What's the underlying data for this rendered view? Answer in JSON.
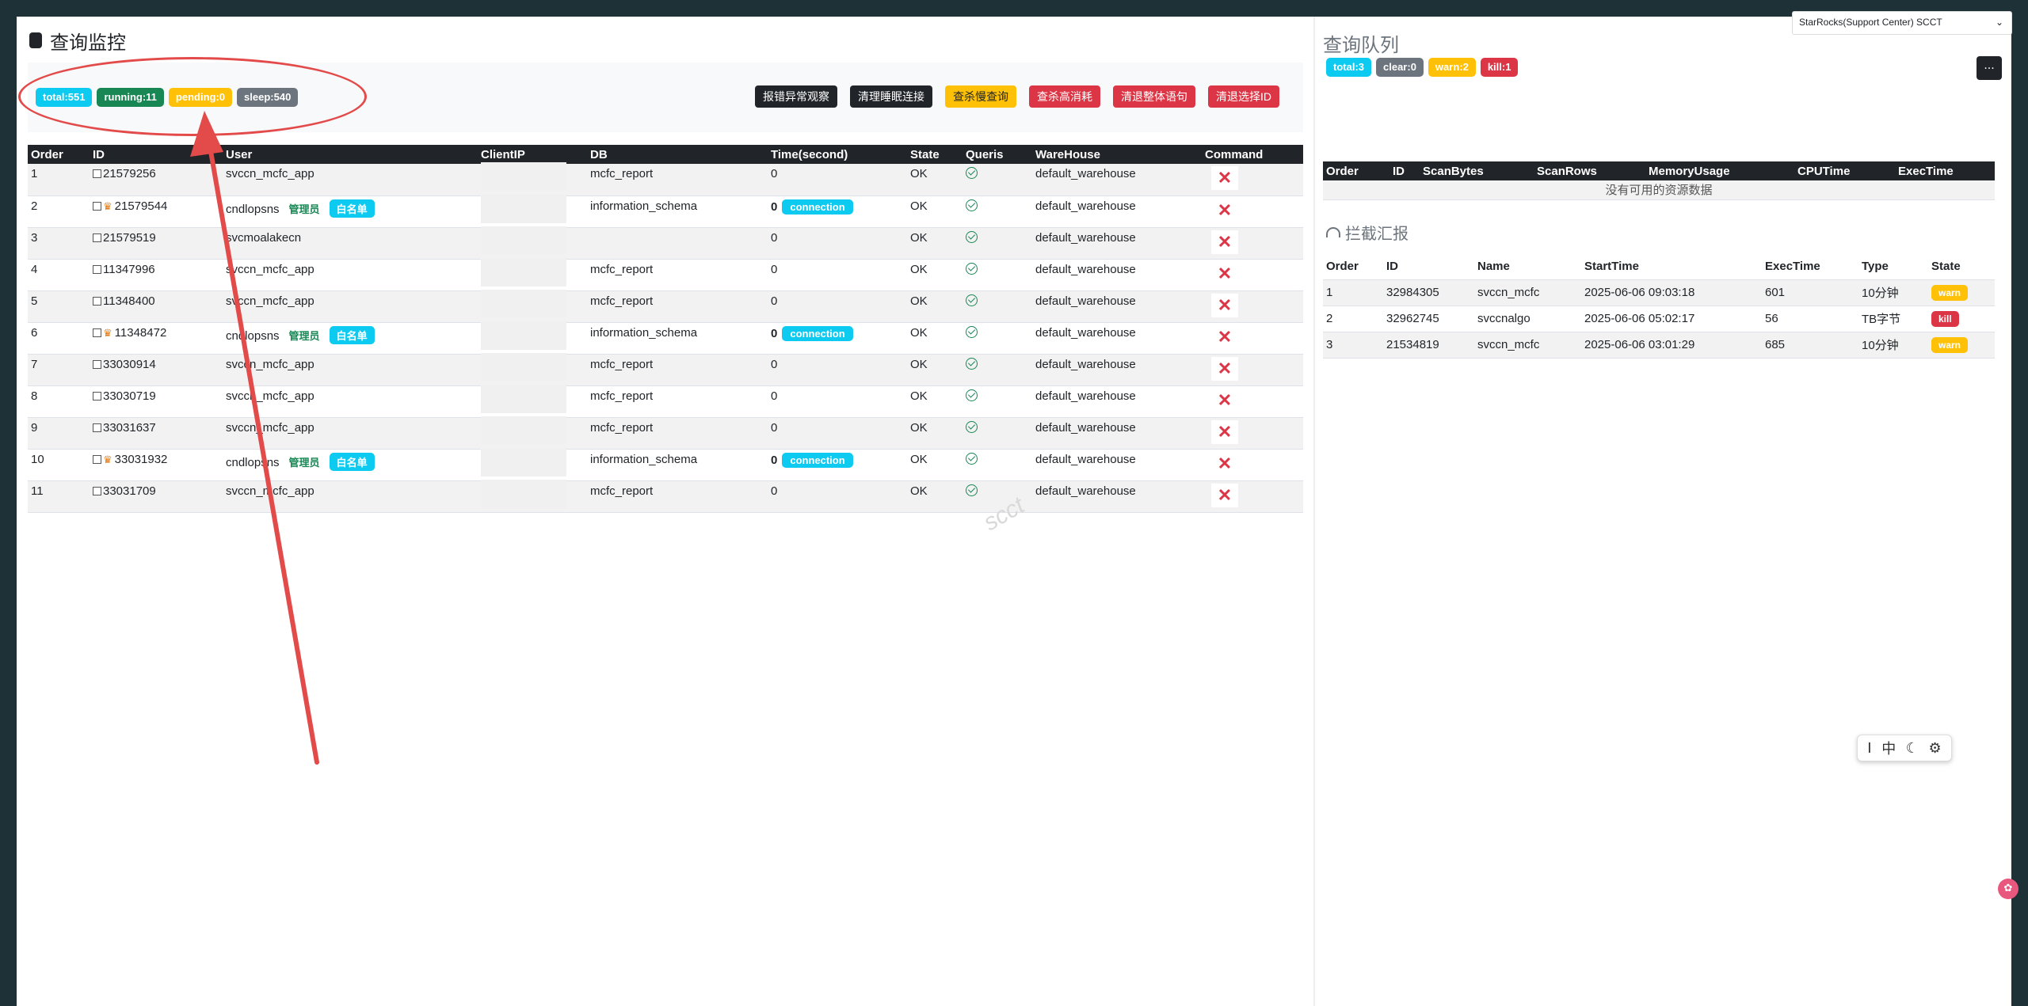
{
  "left": {
    "title": "查询监控",
    "badges": [
      "total:551",
      "running:11",
      "pending:0",
      "sleep:540"
    ],
    "actions": [
      "报错异常观察",
      "清理睡眠连接",
      "查杀慢查询",
      "查杀高消耗",
      "清退整体语句",
      "清退选择ID"
    ],
    "columns": [
      "Order",
      "ID",
      "User",
      "ClientIP",
      "DB",
      "Time(second)",
      "State",
      "Queris",
      "WareHouse",
      "Command"
    ],
    "rows": [
      {
        "order": "1",
        "id": "21579256",
        "user": "svccn_mcfc_app",
        "admin": false,
        "db": "mcfc_report",
        "time": "0",
        "conn": false,
        "state": "OK",
        "wh": "default_warehouse"
      },
      {
        "order": "2",
        "id": "21579544",
        "user": "cndlopsns",
        "admin": true,
        "db": "information_schema",
        "time": "0",
        "conn": true,
        "state": "OK",
        "wh": "default_warehouse"
      },
      {
        "order": "3",
        "id": "21579519",
        "user": "svcmoalakecn",
        "admin": false,
        "db": "",
        "time": "0",
        "conn": false,
        "state": "OK",
        "wh": "default_warehouse"
      },
      {
        "order": "4",
        "id": "11347996",
        "user": "svccn_mcfc_app",
        "admin": false,
        "db": "mcfc_report",
        "time": "0",
        "conn": false,
        "state": "OK",
        "wh": "default_warehouse"
      },
      {
        "order": "5",
        "id": "11348400",
        "user": "svccn_mcfc_app",
        "admin": false,
        "db": "mcfc_report",
        "time": "0",
        "conn": false,
        "state": "OK",
        "wh": "default_warehouse"
      },
      {
        "order": "6",
        "id": "11348472",
        "user": "cndlopsns",
        "admin": true,
        "db": "information_schema",
        "time": "0",
        "conn": true,
        "state": "OK",
        "wh": "default_warehouse"
      },
      {
        "order": "7",
        "id": "33030914",
        "user": "svccn_mcfc_app",
        "admin": false,
        "db": "mcfc_report",
        "time": "0",
        "conn": false,
        "state": "OK",
        "wh": "default_warehouse"
      },
      {
        "order": "8",
        "id": "33030719",
        "user": "svccn_mcfc_app",
        "admin": false,
        "db": "mcfc_report",
        "time": "0",
        "conn": false,
        "state": "OK",
        "wh": "default_warehouse"
      },
      {
        "order": "9",
        "id": "33031637",
        "user": "svccn_mcfc_app",
        "admin": false,
        "db": "mcfc_report",
        "time": "0",
        "conn": false,
        "state": "OK",
        "wh": "default_warehouse"
      },
      {
        "order": "10",
        "id": "33031932",
        "user": "cndlopsns",
        "admin": true,
        "db": "information_schema",
        "time": "0",
        "conn": true,
        "state": "OK",
        "wh": "default_warehouse"
      },
      {
        "order": "11",
        "id": "33031709",
        "user": "svccn_mcfc_app",
        "admin": false,
        "db": "mcfc_report",
        "time": "0",
        "conn": false,
        "state": "OK",
        "wh": "default_warehouse"
      }
    ],
    "role_label": "管理员",
    "whitelist_label": "白名单",
    "conn_label": "connection",
    "kill_glyph": "✕",
    "watermark": "scct"
  },
  "right": {
    "title": "查询队列",
    "badges": [
      "total:3",
      "clear:0",
      "warn:2",
      "kill:1"
    ],
    "more": "...",
    "columns": [
      "Order",
      "ID",
      "ScanBytes",
      "ScanRows",
      "MemoryUsage",
      "CPUTime",
      "ExecTime"
    ],
    "empty": "没有可用的资源数据",
    "intercept_title": "拦截汇报",
    "intercept_columns": [
      "Order",
      "ID",
      "Name",
      "StartTime",
      "ExecTime",
      "Type",
      "State"
    ],
    "intercept_rows": [
      {
        "order": "1",
        "id": "32984305",
        "name": "svccn_mcfc",
        "start": "2025-06-06 09:03:18",
        "exec": "601",
        "type": "10分钟",
        "state": "warn"
      },
      {
        "order": "2",
        "id": "32962745",
        "name": "svccnalgo",
        "start": "2025-06-06 05:02:17",
        "exec": "56",
        "type": "TB字节",
        "state": "kill"
      },
      {
        "order": "3",
        "id": "21534819",
        "name": "svccn_mcfc",
        "start": "2025-06-06 03:01:29",
        "exec": "685",
        "type": "10分钟",
        "state": "warn"
      }
    ]
  },
  "selector": {
    "value": "StarRocks(Support Center) SCCT"
  },
  "ime": {
    "cursor": "I",
    "lang": "中",
    "moon": "☾",
    "gear": "⚙"
  },
  "colors": {
    "cyan": "#0dcaf0",
    "green": "#198754",
    "yellow": "#ffc107",
    "gray": "#6c757d",
    "red": "#dc3545",
    "dark": "#212529",
    "annotation": "#e34a4a"
  }
}
